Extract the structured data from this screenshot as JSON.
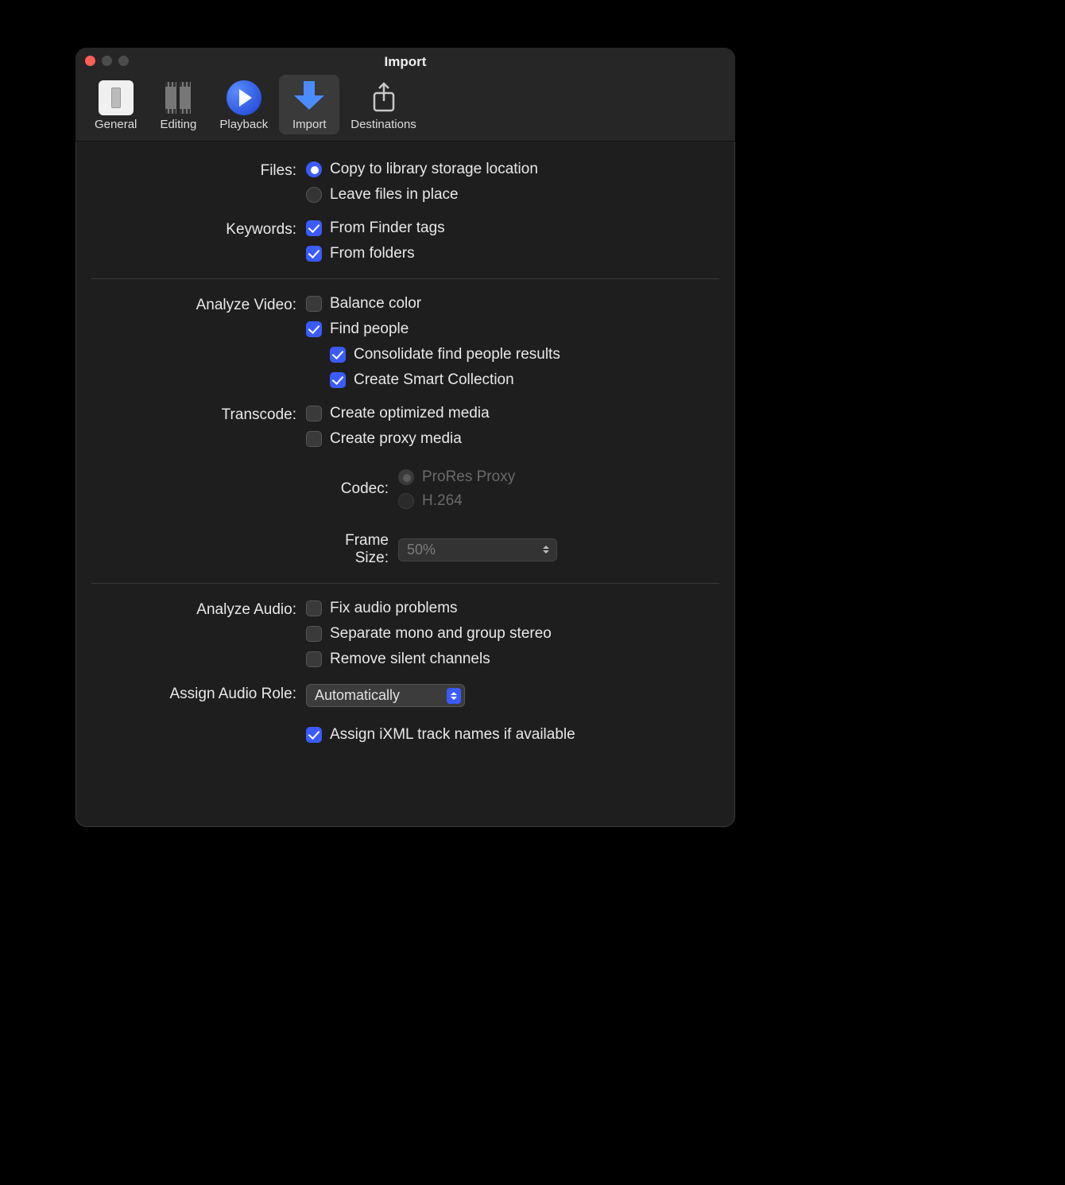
{
  "window": {
    "title": "Import"
  },
  "toolbar": {
    "tabs": [
      {
        "id": "general",
        "label": "General"
      },
      {
        "id": "editing",
        "label": "Editing"
      },
      {
        "id": "playback",
        "label": "Playback"
      },
      {
        "id": "import",
        "label": "Import"
      },
      {
        "id": "destinations",
        "label": "Destinations"
      }
    ],
    "active": "import"
  },
  "sections": {
    "files": {
      "label": "Files:",
      "options": {
        "copy": "Copy to library storage location",
        "leave": "Leave files in place"
      },
      "selected": "copy"
    },
    "keywords": {
      "label": "Keywords:",
      "finder_tags": {
        "label": "From Finder tags",
        "checked": true
      },
      "folders": {
        "label": "From folders",
        "checked": true
      }
    },
    "analyze_video": {
      "label": "Analyze Video:",
      "balance_color": {
        "label": "Balance color",
        "checked": false
      },
      "find_people": {
        "label": "Find people",
        "checked": true
      },
      "consolidate": {
        "label": "Consolidate find people results",
        "checked": true
      },
      "smart_collection": {
        "label": "Create Smart Collection",
        "checked": true
      }
    },
    "transcode": {
      "label": "Transcode:",
      "optimized": {
        "label": "Create optimized media",
        "checked": false
      },
      "proxy": {
        "label": "Create proxy media",
        "checked": false
      },
      "codec": {
        "label": "Codec:",
        "options": {
          "prores": "ProRes Proxy",
          "h264": "H.264"
        },
        "selected": "prores",
        "disabled": true
      },
      "frame_size": {
        "label": "Frame Size:",
        "value": "50%",
        "disabled": true
      }
    },
    "analyze_audio": {
      "label": "Analyze Audio:",
      "fix": {
        "label": "Fix audio problems",
        "checked": false
      },
      "separate": {
        "label": "Separate mono and group stereo",
        "checked": false
      },
      "remove_silent": {
        "label": "Remove silent channels",
        "checked": false
      }
    },
    "assign_role": {
      "label": "Assign Audio Role:",
      "value": "Automatically",
      "ixml": {
        "label": "Assign iXML track names if available",
        "checked": true
      }
    }
  }
}
